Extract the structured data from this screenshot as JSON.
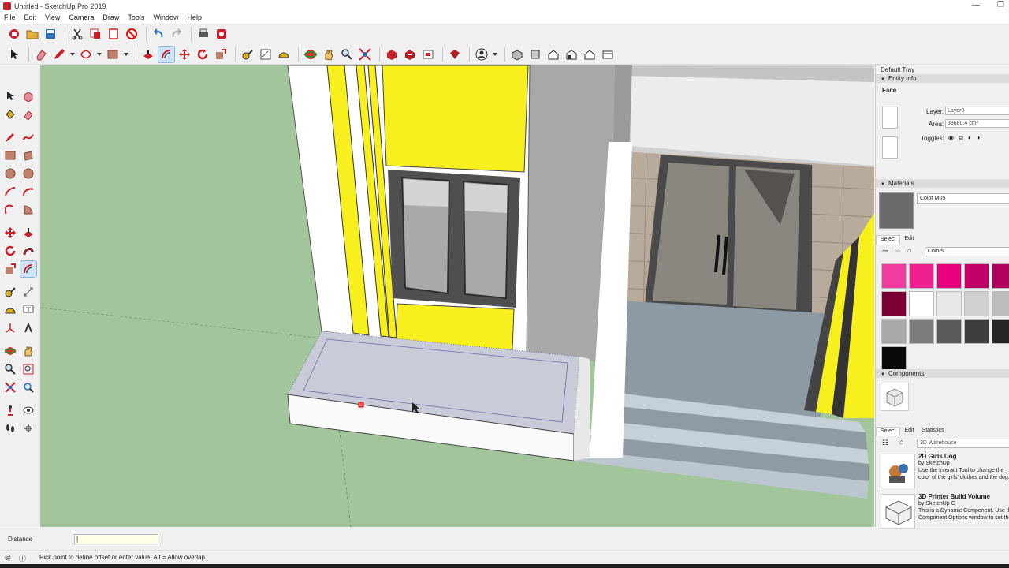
{
  "window": {
    "title": "Untitled - SketchUp Pro 2019",
    "controls": [
      "—",
      "❐"
    ]
  },
  "menu": [
    "File",
    "Edit",
    "View",
    "Camera",
    "Draw",
    "Tools",
    "Window",
    "Help"
  ],
  "measurements": {
    "label": "Distance",
    "value": "|"
  },
  "status": {
    "text": "Pick point to define offset or enter value. Alt = Allow overlap."
  },
  "tray": {
    "title": "Default Tray",
    "entity_info": {
      "header": "Entity Info",
      "type": "Face",
      "layer_label": "Layer:",
      "layer_value": "Layer0",
      "area_label": "Area:",
      "area_value": "38680.4 cm²",
      "toggles_label": "Toggles:"
    },
    "materials": {
      "header": "Materials",
      "current_name": "Color M05",
      "current_color": "#6a6a6c",
      "tab_select": "Select",
      "tab_edit": "Edit",
      "library": "Colors",
      "swatches": [
        "#f03ca0",
        "#ee1f8e",
        "#e8007f",
        "#c2006a",
        "#b0005e",
        "#7a0035",
        "#ffffff",
        "#e8e8e8",
        "#d0d0d0",
        "#bcbcbc",
        "#a9a9a9",
        "#7c7c7c",
        "#5a5a5a",
        "#3c3c3c",
        "#262626",
        "#0a0a0a"
      ]
    },
    "components": {
      "header": "Components",
      "tab_select": "Select",
      "tab_edit": "Edit",
      "tab_statistics": "Statistics",
      "search_value": "3D Warehouse",
      "items": [
        {
          "name": "2D Girls Dog",
          "by": "by SketchUp",
          "desc1": "Use the Interact Tool to change the",
          "desc2": "color of the girls' clothes and the dog."
        },
        {
          "name": "3D Printer Build Volume",
          "by": "by SketchUp C",
          "desc1": "This is a Dynamic Component. Use the",
          "desc2": "Component Options window to set the"
        }
      ]
    }
  }
}
